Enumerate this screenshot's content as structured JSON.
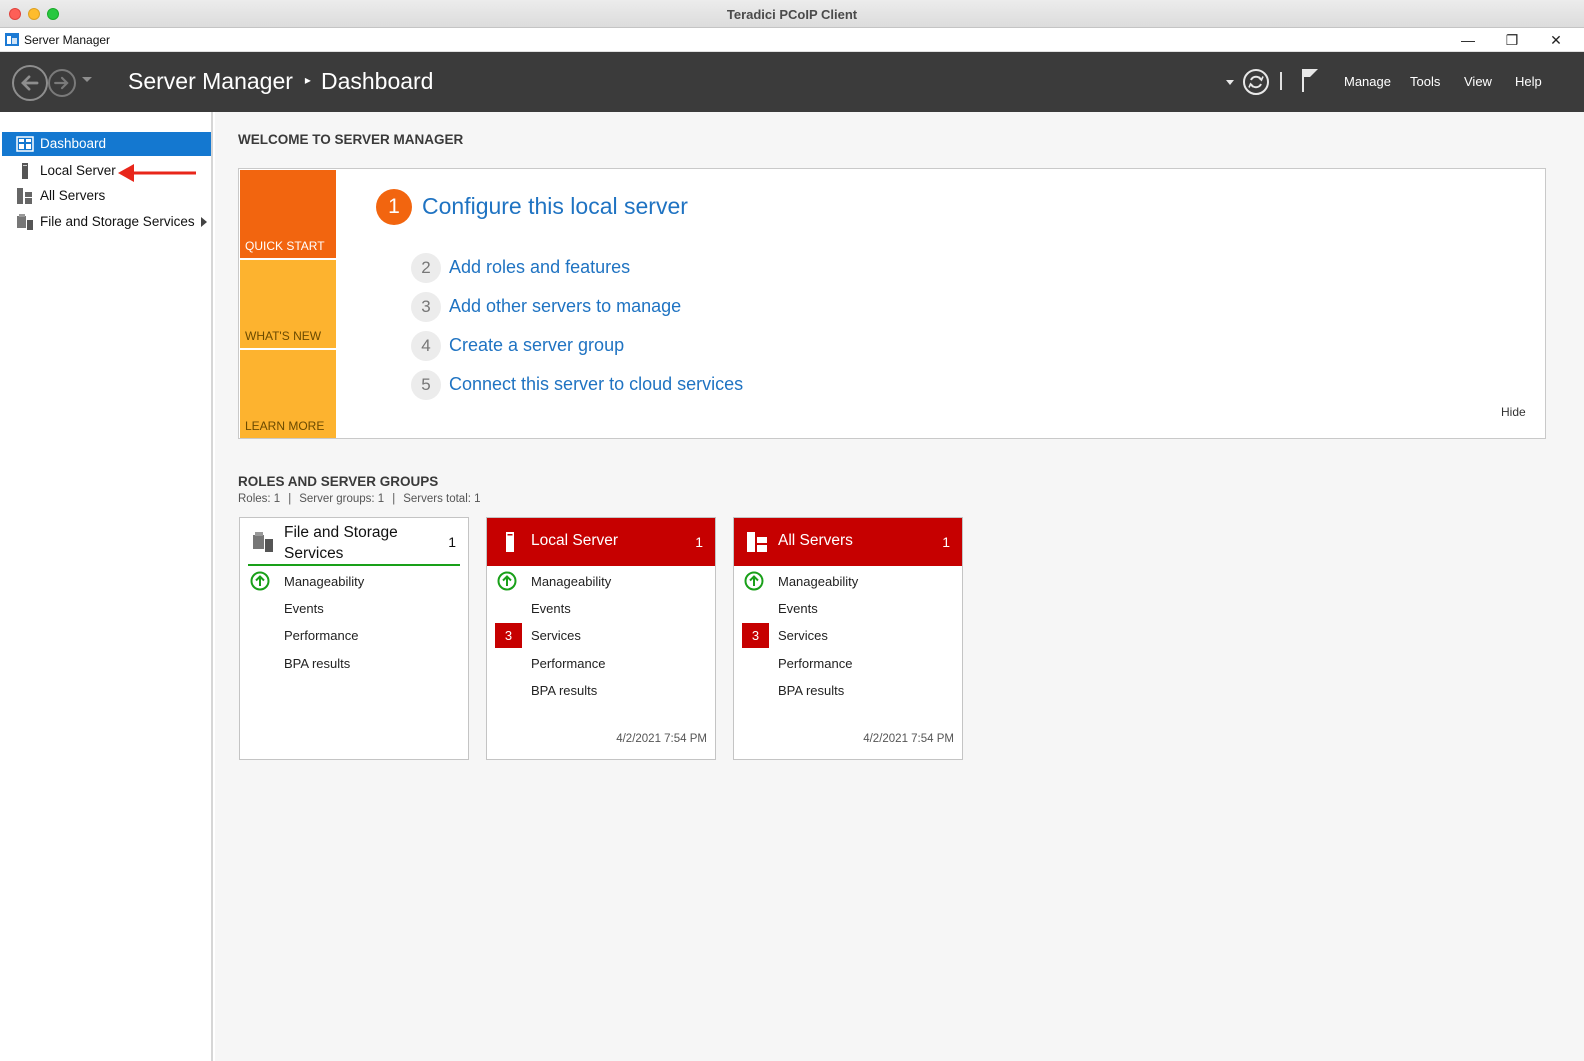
{
  "mac_window": {
    "title": "Teradici PCoIP Client"
  },
  "window": {
    "title": "Server Manager",
    "controls": {
      "minimize": "—",
      "maximize": "❐",
      "close": "✕"
    }
  },
  "header": {
    "breadcrumb": [
      "Server Manager",
      "Dashboard"
    ],
    "breadcrumb_separator": "▸",
    "menus": [
      "Manage",
      "Tools",
      "View",
      "Help"
    ]
  },
  "sidebar": {
    "items": [
      {
        "label": "Dashboard",
        "icon": "dashboard-icon",
        "active": true
      },
      {
        "label": "Local Server",
        "icon": "server-icon",
        "active": false
      },
      {
        "label": "All Servers",
        "icon": "servers-icon",
        "active": false
      },
      {
        "label": "File and Storage Services",
        "icon": "file-storage-icon",
        "active": false,
        "has_submenu": true
      }
    ]
  },
  "welcome": {
    "title": "WELCOME TO SERVER MANAGER",
    "tiles": [
      "QUICK START",
      "WHAT'S NEW",
      "LEARN MORE"
    ],
    "primary_step": {
      "number": "1",
      "label": "Configure this local server"
    },
    "steps": [
      {
        "number": "2",
        "label": "Add roles and features"
      },
      {
        "number": "3",
        "label": "Add other servers to manage"
      },
      {
        "number": "4",
        "label": "Create a server group"
      },
      {
        "number": "5",
        "label": "Connect this server to cloud services"
      }
    ],
    "hide_label": "Hide"
  },
  "roles": {
    "title": "ROLES AND SERVER GROUPS",
    "summary": [
      "Roles: 1",
      "Server groups: 1",
      "Servers total: 1"
    ],
    "cards": [
      {
        "title": "File and Storage Services",
        "count": "1",
        "rows": [
          "Manageability",
          "Events",
          "Performance",
          "BPA results"
        ],
        "date": ""
      },
      {
        "title": "Local Server",
        "count": "1",
        "rows": [
          "Manageability",
          "Events",
          "Services",
          "Performance",
          "BPA results"
        ],
        "services_badge": "3",
        "date": "4/2/2021 7:54 PM"
      },
      {
        "title": "All Servers",
        "count": "1",
        "rows": [
          "Manageability",
          "Events",
          "Services",
          "Performance",
          "BPA results"
        ],
        "services_badge": "3",
        "date": "4/2/2021 7:54 PM"
      }
    ]
  },
  "colors": {
    "header_bg": "#3b3b3b",
    "sidebar_active": "#1478d0",
    "quick_start": "#f2650f",
    "tile_yellow": "#fdb32f",
    "link_blue": "#1f73c2",
    "alert_red": "#c60000",
    "ok_green": "#19a019"
  }
}
